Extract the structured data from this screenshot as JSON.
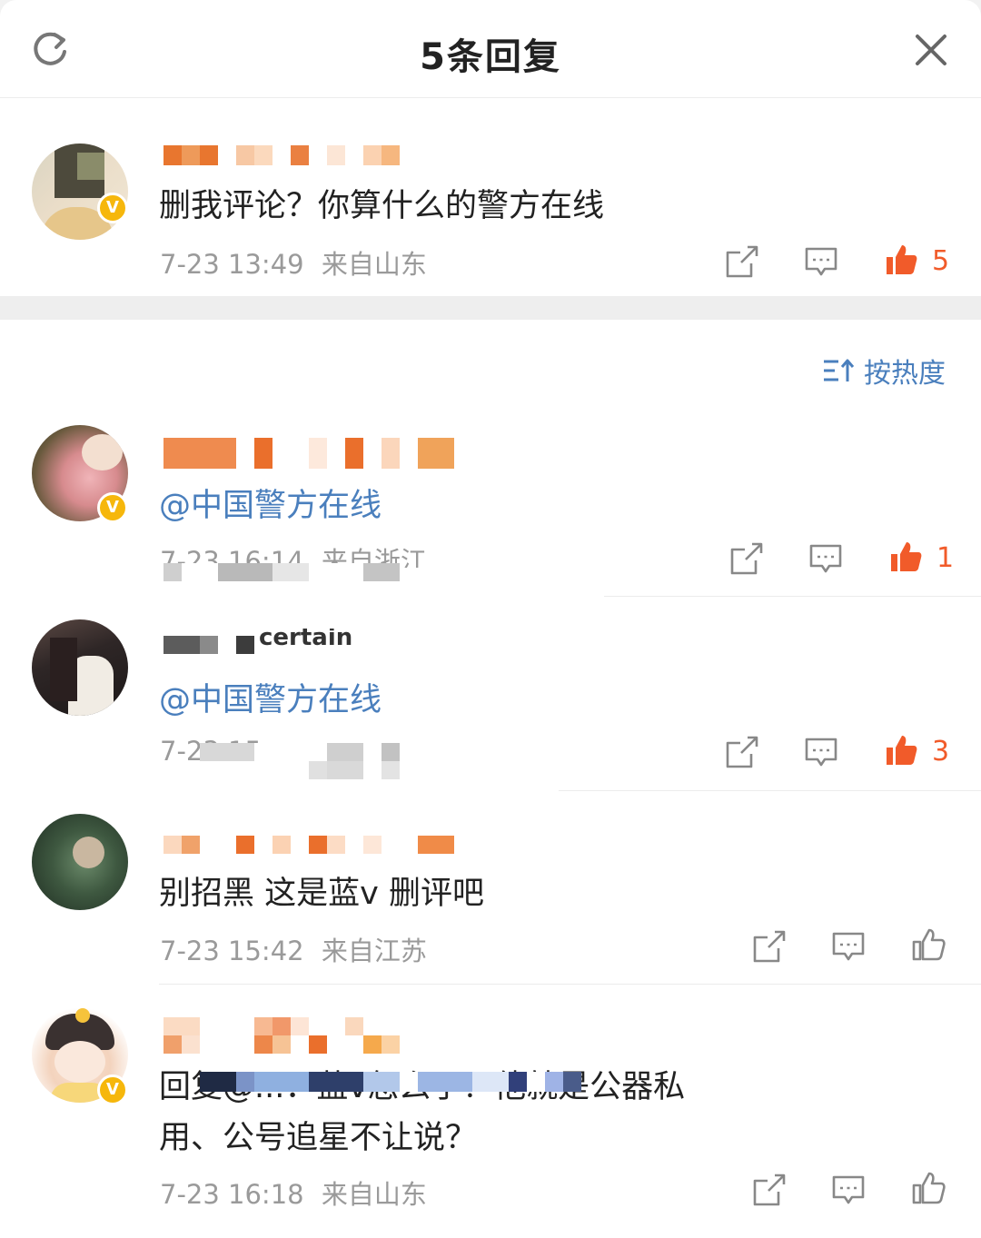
{
  "header": {
    "title": "5条回复"
  },
  "parent_comment": {
    "text": "删我评论？你算什么的警方在线",
    "time": "7-23 13:49",
    "location": "来自山东",
    "likes": "5"
  },
  "sort": {
    "label": "按热度"
  },
  "replies": [
    {
      "mention": "@中国警方在线",
      "text": "",
      "time": "7-23 16:14",
      "location": "来自浙江",
      "likes": "1"
    },
    {
      "username_fragment": "certain",
      "mention": "@中国警方在线",
      "text": "",
      "time": "7-23 15",
      "location": "",
      "likes": "3"
    },
    {
      "text": "别招黑 这是蓝v 删评吧",
      "time": "7-23 15:42",
      "location": "来自江苏",
      "likes": ""
    },
    {
      "text_line1": "回复@...：蓝v怎么了？他就是公器私",
      "text_line2": "用、公号追星不让说？",
      "time": "7-23 16:18",
      "location": "来自山东",
      "likes": ""
    }
  ],
  "colors": {
    "accent_blue": "#4a7fbd",
    "like_orange": "#f15b2a",
    "meta_gray": "#9a9a9a",
    "badge_gold": "#f6b70c"
  },
  "icons": [
    "refresh-icon",
    "close-icon",
    "share-icon",
    "comment-icon",
    "like-icon",
    "sort-icon",
    "verified-badge-icon"
  ]
}
